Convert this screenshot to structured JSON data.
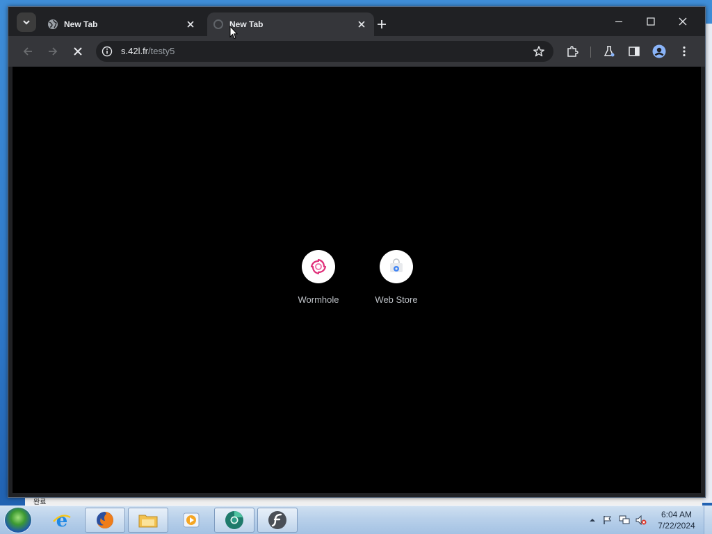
{
  "tabs": [
    {
      "title": "New Tab",
      "favicon": "globe-icon"
    },
    {
      "title": "New Tab",
      "favicon": "loading-icon"
    }
  ],
  "address_bar": {
    "host": "s.42l.fr",
    "path": "/testy5"
  },
  "shortcuts": [
    {
      "label": "Wormhole",
      "icon": "wormhole-icon"
    },
    {
      "label": "Web Store",
      "icon": "webstore-icon"
    }
  ],
  "status_bar": {
    "text": "완료"
  },
  "taskbar": {
    "apps": [
      "internet-explorer-icon",
      "firefox-icon",
      "file-explorer-icon",
      "media-player-icon",
      "chrome-dev-icon",
      "flash-icon"
    ]
  },
  "clock": {
    "time": "6:04 AM",
    "date": "7/22/2024"
  },
  "colors": {
    "frame": "#202124",
    "toolbar": "#35363a",
    "content": "#000000"
  }
}
